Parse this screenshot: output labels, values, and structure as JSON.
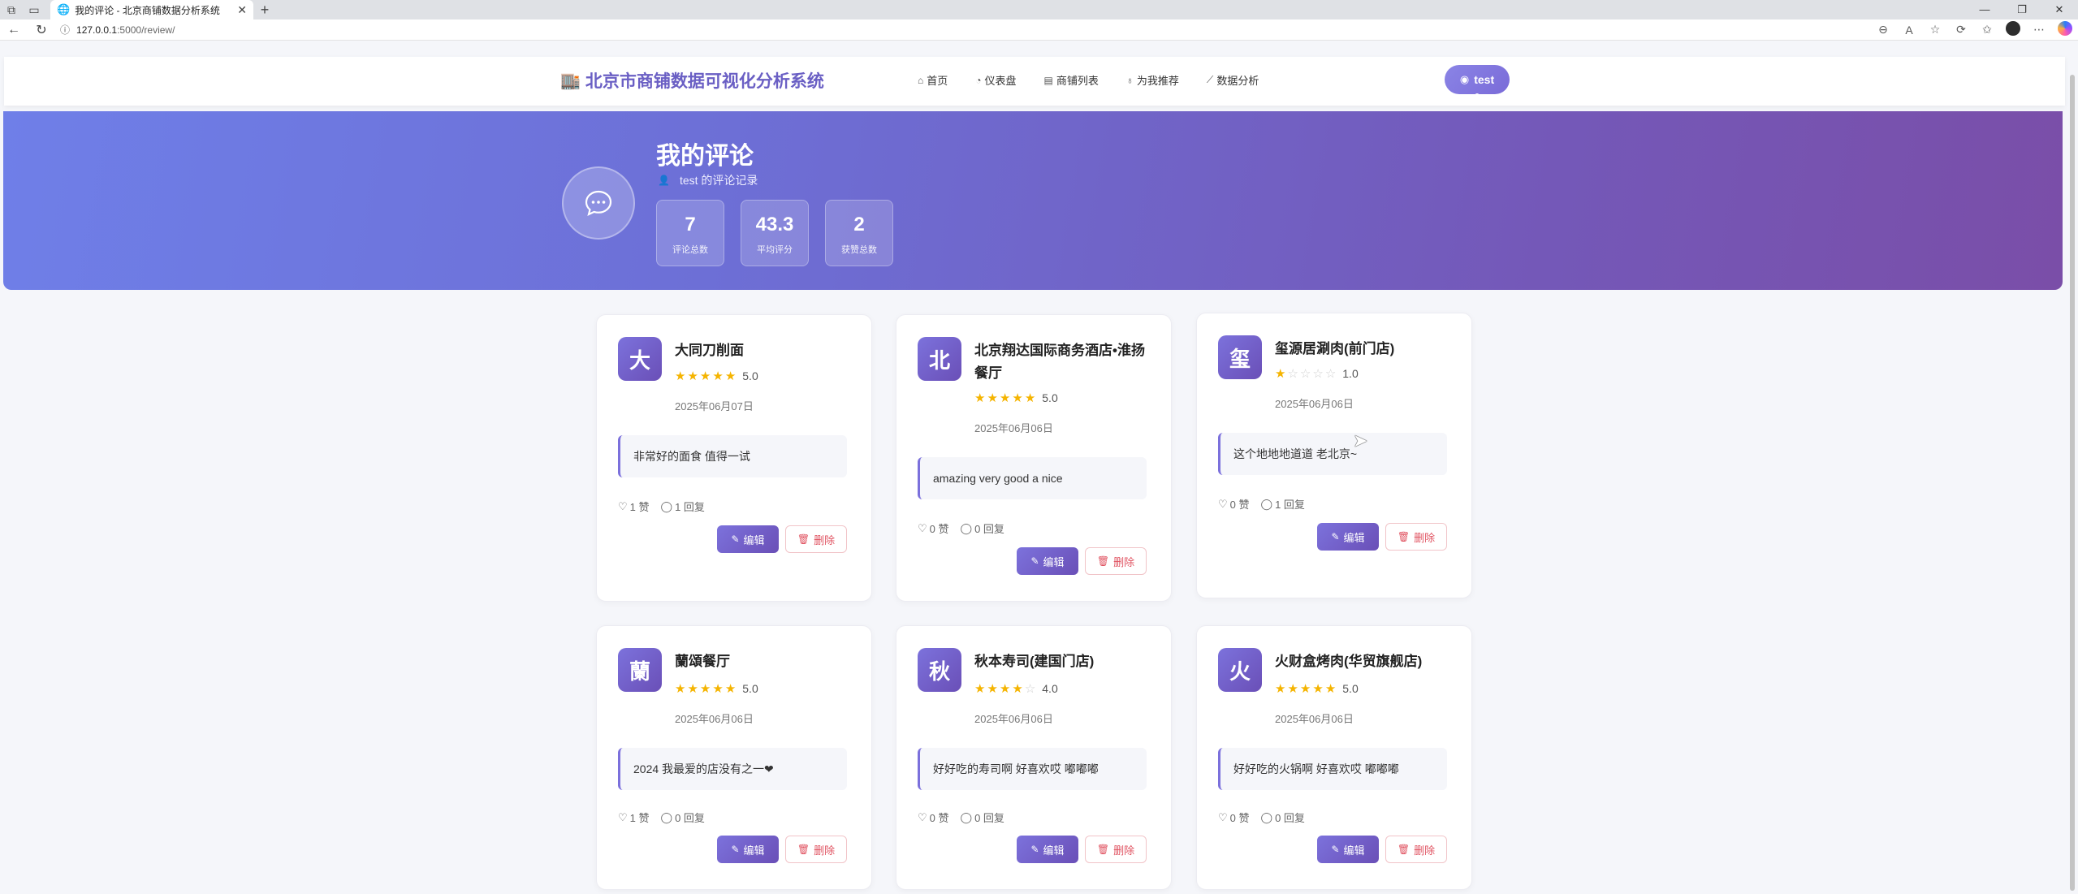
{
  "browser": {
    "tab_title": "我的评论 - 北京商铺数据分析系统",
    "url_host": "127.0.0.1",
    "url_path": ":5000/review/"
  },
  "site": {
    "brand": "北京市商铺数据可视化分析系统",
    "menu": [
      "首页",
      "仪表盘",
      "商铺列表",
      "为我推荐",
      "数据分析"
    ],
    "user": "test"
  },
  "hero": {
    "title": "我的评论",
    "subtitle": "test 的评论记录",
    "stats": [
      {
        "value": "7",
        "label": "评论总数"
      },
      {
        "value": "43.3",
        "label": "平均评分"
      },
      {
        "value": "2",
        "label": "获赞总数"
      }
    ]
  },
  "accent": "#6a5fc4",
  "reviews": [
    {
      "initial": "大",
      "name": "大同刀削面",
      "stars": 5,
      "score": "5.0",
      "date": "2025年06月07日",
      "text": "非常好的面食 值得一试",
      "likes": "1 赞",
      "replies": "1 回复"
    },
    {
      "initial": "北",
      "name": "北京翔达国际商务酒店•淮扬餐厅",
      "stars": 5,
      "score": "5.0",
      "date": "2025年06月06日",
      "text": "amazing very good a nice",
      "likes": "0 赞",
      "replies": "0 回复"
    },
    {
      "initial": "玺",
      "name": "玺源居涮肉(前门店)",
      "stars": 1,
      "score": "1.0",
      "date": "2025年06月06日",
      "text": "这个地地地道道 老北京~",
      "likes": "0 赞",
      "replies": "1 回复"
    },
    {
      "initial": "蘭",
      "name": "蘭頌餐厅",
      "stars": 5,
      "score": "5.0",
      "date": "2025年06月06日",
      "text": "2024 我最爱的店没有之一❤",
      "likes": "1 赞",
      "replies": "0 回复"
    },
    {
      "initial": "秋",
      "name": "秋本寿司(建国门店)",
      "stars": 4,
      "score": "4.0",
      "date": "2025年06月06日",
      "text": "好好吃的寿司啊 好喜欢哎 嘟嘟嘟",
      "likes": "0 赞",
      "replies": "0 回复"
    },
    {
      "initial": "火",
      "name": "火财盒烤肉(华贸旗舰店)",
      "stars": 5,
      "score": "5.0",
      "date": "2025年06月06日",
      "text": "好好吃的火锅啊 好喜欢哎 嘟嘟嘟",
      "likes": "0 赞",
      "replies": "0 回复"
    }
  ],
  "buttons": {
    "edit": "编辑",
    "delete": "删除"
  }
}
